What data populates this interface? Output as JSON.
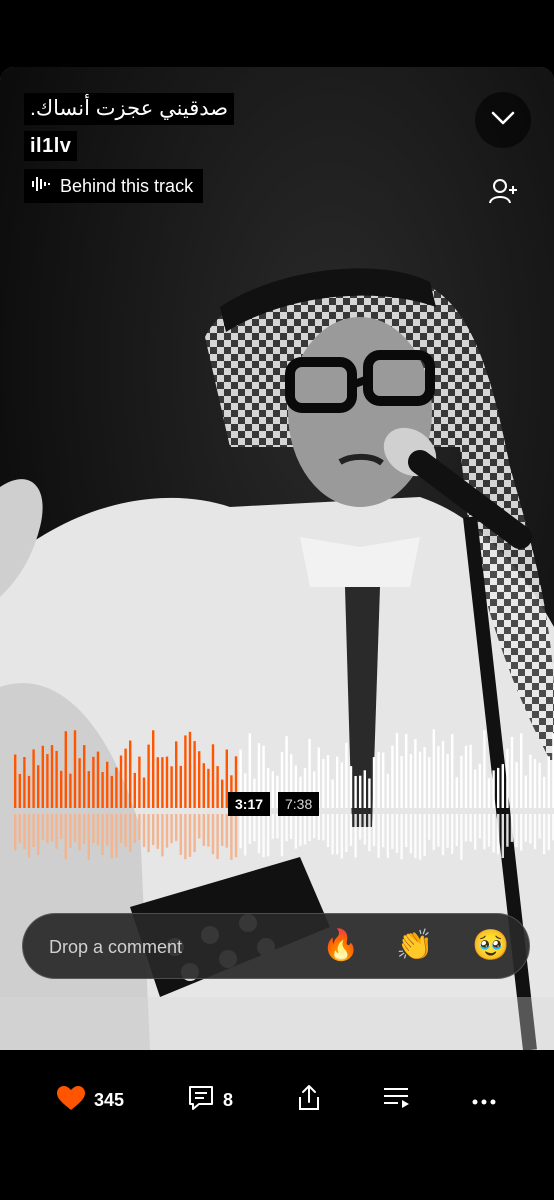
{
  "track": {
    "title": "صدقيني عجزت أنساك.",
    "artist": "il1lv",
    "behind_label": "Behind this track"
  },
  "player": {
    "current_time": "3:17",
    "total_time": "7:38",
    "progress": 0.43
  },
  "comment": {
    "placeholder": "Drop a comment",
    "reactions": [
      "🔥",
      "👏",
      "🥹"
    ]
  },
  "actions": {
    "likes": "345",
    "comments": "8"
  },
  "colors": {
    "accent": "#ff5500",
    "played_bottom": "#f3b58f",
    "unplayed": "#ffffff"
  },
  "icons": [
    "chevron-down-icon",
    "follow-user-icon",
    "waveform-icon",
    "heart-icon",
    "comment-icon",
    "share-icon",
    "playlist-icon",
    "more-icon"
  ]
}
